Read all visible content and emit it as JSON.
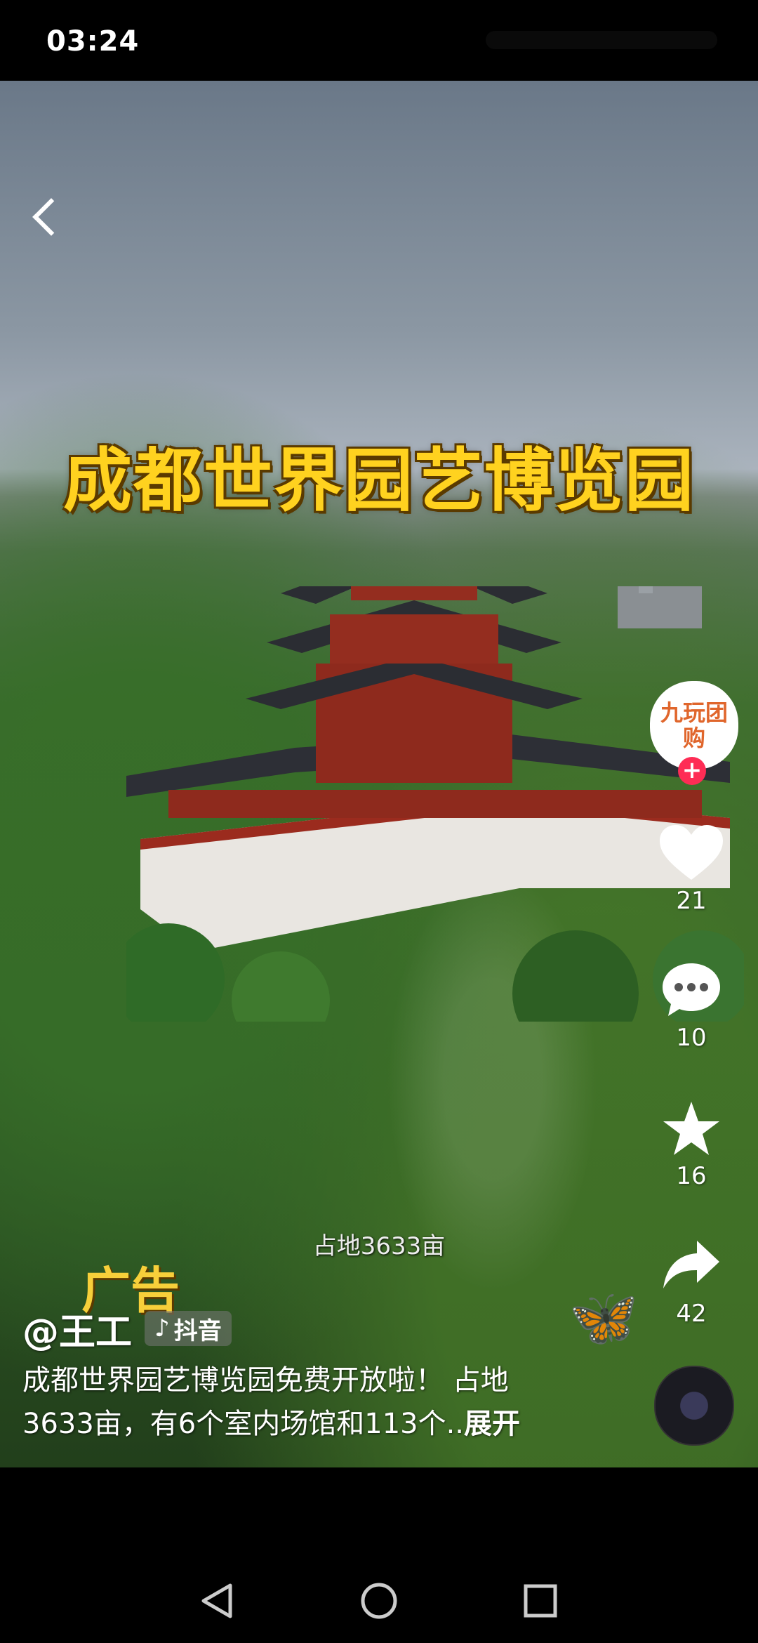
{
  "status_bar": {
    "time": "03:24"
  },
  "video": {
    "headline": "成都世界园艺博览园",
    "caption": "占地3633亩",
    "ad_label": "广告"
  },
  "author": {
    "name": "@王工",
    "badge_label": "抖音"
  },
  "description": {
    "text": "成都世界园艺博览园免费开放啦！ 占地3633亩，有6个室内场馆和113个..",
    "expand_label": "展开"
  },
  "sidebar": {
    "avatar_text": "九玩团购",
    "like_count": "21",
    "comment_count": "10",
    "favorite_count": "16",
    "share_count": "42"
  },
  "colors": {
    "headline": "#ffd21f",
    "follow": "#fe2c55"
  }
}
